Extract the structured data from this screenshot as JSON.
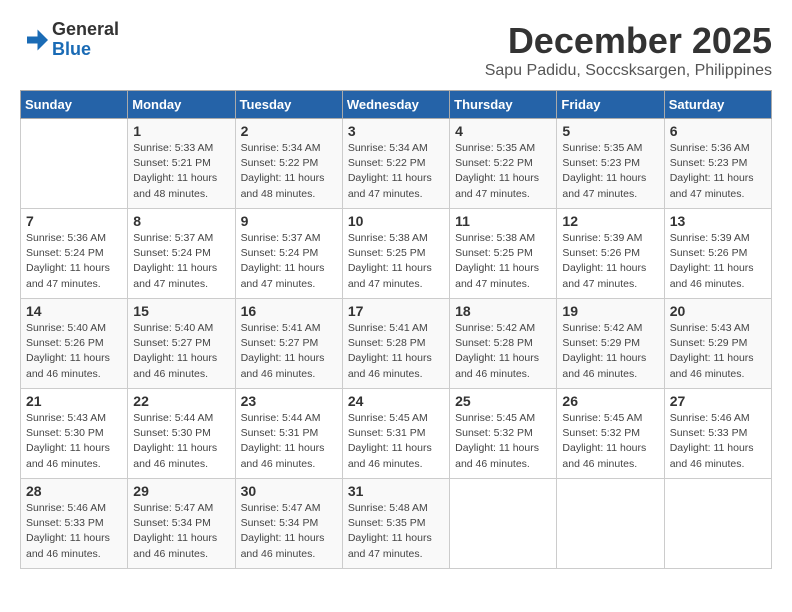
{
  "header": {
    "logo_general": "General",
    "logo_blue": "Blue",
    "month_title": "December 2025",
    "subtitle": "Sapu Padidu, Soccsksargen, Philippines"
  },
  "weekdays": [
    "Sunday",
    "Monday",
    "Tuesday",
    "Wednesday",
    "Thursday",
    "Friday",
    "Saturday"
  ],
  "weeks": [
    [
      {
        "day": "",
        "info": ""
      },
      {
        "day": "1",
        "info": "Sunrise: 5:33 AM\nSunset: 5:21 PM\nDaylight: 11 hours\nand 48 minutes."
      },
      {
        "day": "2",
        "info": "Sunrise: 5:34 AM\nSunset: 5:22 PM\nDaylight: 11 hours\nand 48 minutes."
      },
      {
        "day": "3",
        "info": "Sunrise: 5:34 AM\nSunset: 5:22 PM\nDaylight: 11 hours\nand 47 minutes."
      },
      {
        "day": "4",
        "info": "Sunrise: 5:35 AM\nSunset: 5:22 PM\nDaylight: 11 hours\nand 47 minutes."
      },
      {
        "day": "5",
        "info": "Sunrise: 5:35 AM\nSunset: 5:23 PM\nDaylight: 11 hours\nand 47 minutes."
      },
      {
        "day": "6",
        "info": "Sunrise: 5:36 AM\nSunset: 5:23 PM\nDaylight: 11 hours\nand 47 minutes."
      }
    ],
    [
      {
        "day": "7",
        "info": "Sunrise: 5:36 AM\nSunset: 5:24 PM\nDaylight: 11 hours\nand 47 minutes."
      },
      {
        "day": "8",
        "info": "Sunrise: 5:37 AM\nSunset: 5:24 PM\nDaylight: 11 hours\nand 47 minutes."
      },
      {
        "day": "9",
        "info": "Sunrise: 5:37 AM\nSunset: 5:24 PM\nDaylight: 11 hours\nand 47 minutes."
      },
      {
        "day": "10",
        "info": "Sunrise: 5:38 AM\nSunset: 5:25 PM\nDaylight: 11 hours\nand 47 minutes."
      },
      {
        "day": "11",
        "info": "Sunrise: 5:38 AM\nSunset: 5:25 PM\nDaylight: 11 hours\nand 47 minutes."
      },
      {
        "day": "12",
        "info": "Sunrise: 5:39 AM\nSunset: 5:26 PM\nDaylight: 11 hours\nand 47 minutes."
      },
      {
        "day": "13",
        "info": "Sunrise: 5:39 AM\nSunset: 5:26 PM\nDaylight: 11 hours\nand 46 minutes."
      }
    ],
    [
      {
        "day": "14",
        "info": "Sunrise: 5:40 AM\nSunset: 5:26 PM\nDaylight: 11 hours\nand 46 minutes."
      },
      {
        "day": "15",
        "info": "Sunrise: 5:40 AM\nSunset: 5:27 PM\nDaylight: 11 hours\nand 46 minutes."
      },
      {
        "day": "16",
        "info": "Sunrise: 5:41 AM\nSunset: 5:27 PM\nDaylight: 11 hours\nand 46 minutes."
      },
      {
        "day": "17",
        "info": "Sunrise: 5:41 AM\nSunset: 5:28 PM\nDaylight: 11 hours\nand 46 minutes."
      },
      {
        "day": "18",
        "info": "Sunrise: 5:42 AM\nSunset: 5:28 PM\nDaylight: 11 hours\nand 46 minutes."
      },
      {
        "day": "19",
        "info": "Sunrise: 5:42 AM\nSunset: 5:29 PM\nDaylight: 11 hours\nand 46 minutes."
      },
      {
        "day": "20",
        "info": "Sunrise: 5:43 AM\nSunset: 5:29 PM\nDaylight: 11 hours\nand 46 minutes."
      }
    ],
    [
      {
        "day": "21",
        "info": "Sunrise: 5:43 AM\nSunset: 5:30 PM\nDaylight: 11 hours\nand 46 minutes."
      },
      {
        "day": "22",
        "info": "Sunrise: 5:44 AM\nSunset: 5:30 PM\nDaylight: 11 hours\nand 46 minutes."
      },
      {
        "day": "23",
        "info": "Sunrise: 5:44 AM\nSunset: 5:31 PM\nDaylight: 11 hours\nand 46 minutes."
      },
      {
        "day": "24",
        "info": "Sunrise: 5:45 AM\nSunset: 5:31 PM\nDaylight: 11 hours\nand 46 minutes."
      },
      {
        "day": "25",
        "info": "Sunrise: 5:45 AM\nSunset: 5:32 PM\nDaylight: 11 hours\nand 46 minutes."
      },
      {
        "day": "26",
        "info": "Sunrise: 5:45 AM\nSunset: 5:32 PM\nDaylight: 11 hours\nand 46 minutes."
      },
      {
        "day": "27",
        "info": "Sunrise: 5:46 AM\nSunset: 5:33 PM\nDaylight: 11 hours\nand 46 minutes."
      }
    ],
    [
      {
        "day": "28",
        "info": "Sunrise: 5:46 AM\nSunset: 5:33 PM\nDaylight: 11 hours\nand 46 minutes."
      },
      {
        "day": "29",
        "info": "Sunrise: 5:47 AM\nSunset: 5:34 PM\nDaylight: 11 hours\nand 46 minutes."
      },
      {
        "day": "30",
        "info": "Sunrise: 5:47 AM\nSunset: 5:34 PM\nDaylight: 11 hours\nand 46 minutes."
      },
      {
        "day": "31",
        "info": "Sunrise: 5:48 AM\nSunset: 5:35 PM\nDaylight: 11 hours\nand 47 minutes."
      },
      {
        "day": "",
        "info": ""
      },
      {
        "day": "",
        "info": ""
      },
      {
        "day": "",
        "info": ""
      }
    ]
  ]
}
